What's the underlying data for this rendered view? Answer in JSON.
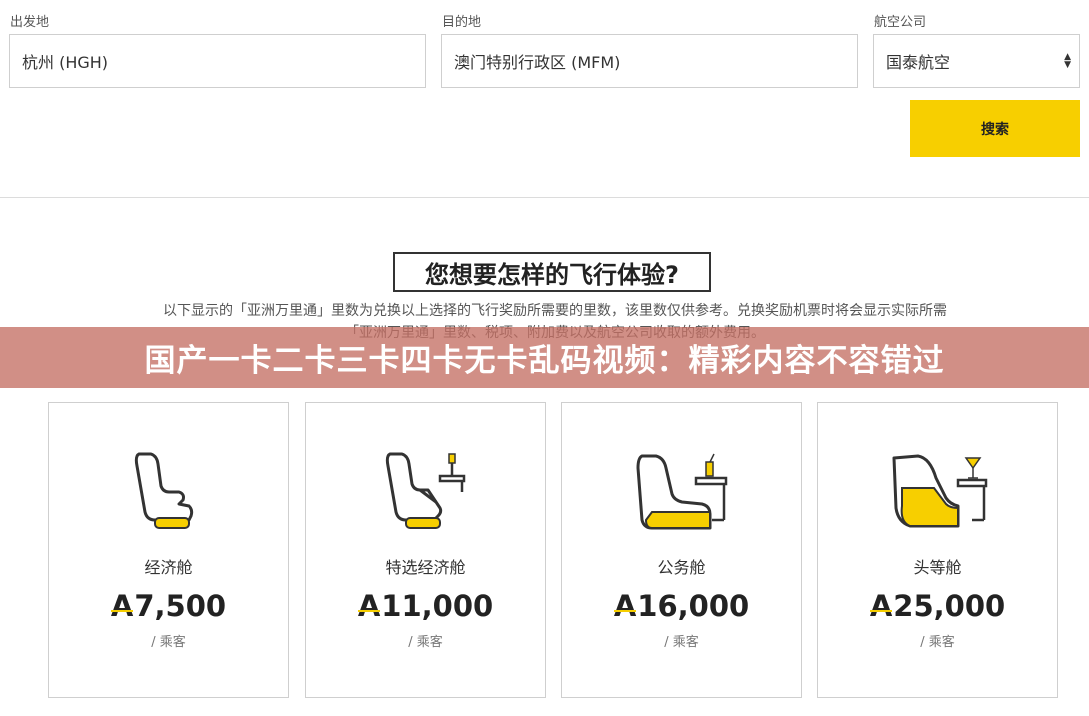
{
  "form": {
    "origin_label": "出发地",
    "origin_value": "杭州 (HGH)",
    "destination_label": "目的地",
    "destination_value": "澳门特别行政区 (MFM)",
    "airline_label": "航空公司",
    "airline_value": "国泰航空",
    "search_label": "搜索"
  },
  "section": {
    "heading": "您想要怎样的飞行体验?",
    "description_line1": "以下显示的「亚洲万里通」里数为兑换以上选择的飞行奖励所需要的里数，该里数仅供参考。兑换奖励机票时将会显示实际所需",
    "description_line2": "「亚洲万里通」里数、税项、附加费以及航空公司收取的额外费用。"
  },
  "banner": {
    "text": "国产一卡二卡三卡四卡无卡乱码视频：精彩内容不容错过"
  },
  "cards": [
    {
      "icon": "economy-seat-icon",
      "name": "经济舱",
      "currency": "A",
      "price": "7,500",
      "unit": "/ 乘客"
    },
    {
      "icon": "premium-economy-seat-icon",
      "name": "特选经济舱",
      "currency": "A",
      "price": "11,000",
      "unit": "/ 乘客"
    },
    {
      "icon": "business-seat-icon",
      "name": "公务舱",
      "currency": "A",
      "price": "16,000",
      "unit": "/ 乘客"
    },
    {
      "icon": "first-class-seat-icon",
      "name": "头等舱",
      "currency": "A",
      "price": "25,000",
      "unit": "/ 乘客"
    }
  ],
  "colors": {
    "accent": "#f7cf00",
    "banner": "#c47064",
    "border": "#cfcfcf"
  }
}
